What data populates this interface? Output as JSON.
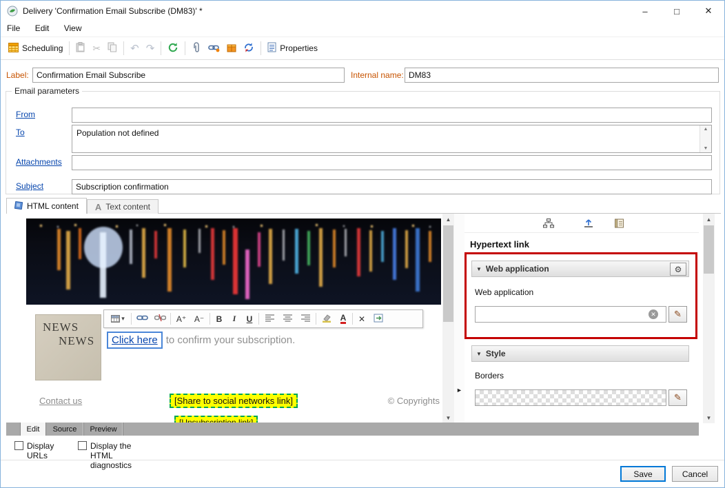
{
  "colors": {
    "accent": "#0078d7",
    "mandatory_label": "#c75300",
    "link": "#0645ad",
    "highlight_border": "#c40000",
    "share_highlight_bg": "#ffff00",
    "share_highlight_border": "#00a651"
  },
  "window": {
    "title": "Delivery 'Confirmation Email Subscribe (DM83)' *",
    "minimize_glyph": "–",
    "maximize_glyph": "□",
    "close_glyph": "✕"
  },
  "menu": {
    "file": "File",
    "edit": "Edit",
    "view": "View"
  },
  "toolbar": {
    "scheduling": "Scheduling",
    "properties": "Properties",
    "cut_glyph": "✂",
    "undo_glyph": "↶",
    "redo_glyph": "↷"
  },
  "header_form": {
    "label_caption": "Label:",
    "label_value": "Confirmation Email Subscribe",
    "internal_caption": "Internal name:",
    "internal_value": "DM83"
  },
  "email_params": {
    "legend": "Email parameters",
    "from_label": "From",
    "from_value": "",
    "to_label": "To",
    "to_value": "Population not defined",
    "attachments_label": "Attachments",
    "attachments_value": "",
    "subject_label": "Subject",
    "subject_value": "Subscription confirmation"
  },
  "content_tabs": {
    "html": "HTML content",
    "text": "Text content",
    "text_icon": "A"
  },
  "editor": {
    "logo_top": "NEWS",
    "logo_bottom": "NEWS",
    "link_text": "Click here",
    "after_link": "to confirm your subscription.",
    "contact": "Contact us",
    "share_link": "[Share to social networks link]",
    "copyright": "© Copyrights",
    "unsubscribe_link": "[Unsubscription link]"
  },
  "format_toolbar": {
    "table_caret": "▾",
    "font_increase": "A⁺",
    "font_decrease": "A⁻",
    "bold": "B",
    "italic": "I",
    "underline": "U",
    "font_color": "A",
    "remove": "✕"
  },
  "props_panel": {
    "heading": "Hypertext link",
    "collapse_glyph": "▼",
    "web_app_header": "Web application",
    "gear_glyph": "⚙",
    "web_app_label": "Web application",
    "web_app_value": "",
    "clear_glyph": "✕",
    "pencil_glyph": "✎",
    "style_header": "Style",
    "borders_label": "Borders"
  },
  "scroll": {
    "up": "▲",
    "down": "▼",
    "expand": "►"
  },
  "bottom_tabs": {
    "edit": "Edit",
    "source": "Source",
    "preview": "Preview"
  },
  "options": {
    "display_urls": "Display URLs",
    "display_diagnostics": "Display the HTML diagnostics"
  },
  "buttons": {
    "save": "Save",
    "cancel": "Cancel"
  }
}
